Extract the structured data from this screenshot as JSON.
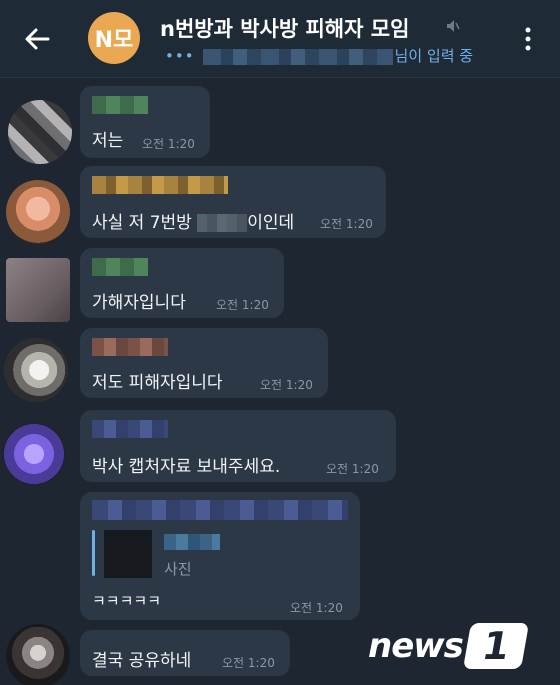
{
  "header": {
    "title": "n번방과 박사방 피해자 모임",
    "avatar_text": "N모",
    "avatar_color": "#e9a851",
    "status_suffix": "님이 입력 중",
    "typing_indicator": "•••"
  },
  "messages": [
    {
      "text": "저는",
      "time": "오전 1:20"
    },
    {
      "text_before": "사실 저 7번방 ",
      "text_after": "이인데",
      "time": "오전 1:20"
    },
    {
      "text": "가해자입니다",
      "time": "오전 1:20"
    },
    {
      "text": "저도 피해자입니다",
      "time": "오전 1:20"
    },
    {
      "text": "박사 캡처자료 보내주세요.",
      "time": "오전 1:20"
    },
    {
      "reply_label": "사진",
      "text": "ㅋㅋㅋㅋㅋ",
      "time": "오전 1:20"
    },
    {
      "text": "결국 공유하네",
      "time": "오전 1:20"
    }
  ],
  "watermark": {
    "text": "news",
    "mark": "1"
  }
}
